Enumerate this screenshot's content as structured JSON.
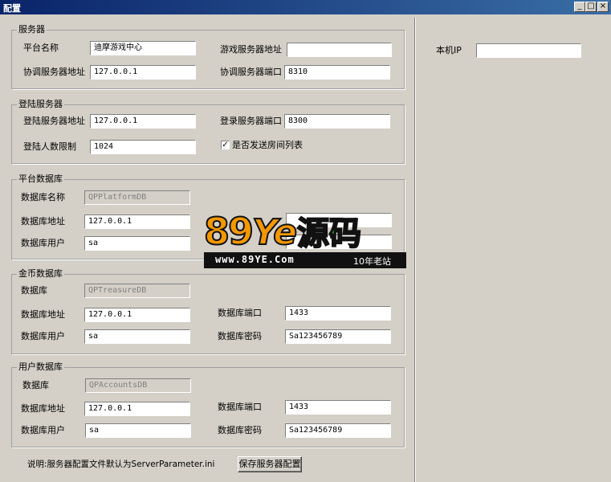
{
  "window": {
    "title": "配置",
    "minimize": "_",
    "maximize": "□",
    "close": "×"
  },
  "server": {
    "group_title": "服务器",
    "platform_name_label": "平台名称",
    "platform_name_value": "迪摩游戏中心",
    "game_server_addr_label": "游戏服务器地址",
    "game_server_addr_value": "",
    "coord_addr_label": "协调服务器地址",
    "coord_addr_value": "127.0.0.1",
    "coord_port_label": "协调服务器端口",
    "coord_port_value": "8310"
  },
  "login": {
    "group_title": "登陆服务器",
    "addr_label": "登陆服务器地址",
    "addr_value": "127.0.0.1",
    "port_label": "登录服务器端口",
    "port_value": "8300",
    "limit_label": "登陆人数限制",
    "limit_value": "1024",
    "send_room_list_label": "是否发送房间列表",
    "send_room_list_checked": true,
    "check_mark": "✓"
  },
  "platform_db": {
    "group_title": "平台数据库",
    "name_label": "数据库名称",
    "name_value": "QPPlatformDB",
    "addr_label": "数据库地址",
    "addr_value": "127.0.0.1",
    "user_label": "数据库用户",
    "user_value": "sa"
  },
  "treasure_db": {
    "group_title": "金币数据库",
    "db_label": "数据库",
    "db_value": "QPTreasureDB",
    "addr_label": "数据库地址",
    "addr_value": "127.0.0.1",
    "port_label": "数据库端口",
    "port_value": "1433",
    "user_label": "数据库用户",
    "user_value": "sa",
    "pass_label": "数据库密码",
    "pass_value": "Sa123456789"
  },
  "accounts_db": {
    "group_title": "用户数据库",
    "db_label": "数据库",
    "db_value": "QPAccountsDB",
    "addr_label": "数据库地址",
    "addr_value": "127.0.0.1",
    "port_label": "数据库端口",
    "port_value": "1433",
    "user_label": "数据库用户",
    "user_value": "sa",
    "pass_label": "数据库密码",
    "pass_value": "Sa123456789"
  },
  "footer": {
    "note": "说明:服务器配置文件默认为ServerParameter.ini",
    "save_button": "保存服务器配置"
  },
  "right_panel": {
    "local_ip_label": "本机IP",
    "local_ip_value": ""
  },
  "watermark": {
    "brand_89": "89",
    "brand_ye": "Ye",
    "brand_cn": "源码",
    "url": "www.89YE.Com",
    "tagline": "10年老站",
    "colors": {
      "orange": "#f39800",
      "green": "#22ac38",
      "black": "#111111"
    }
  }
}
